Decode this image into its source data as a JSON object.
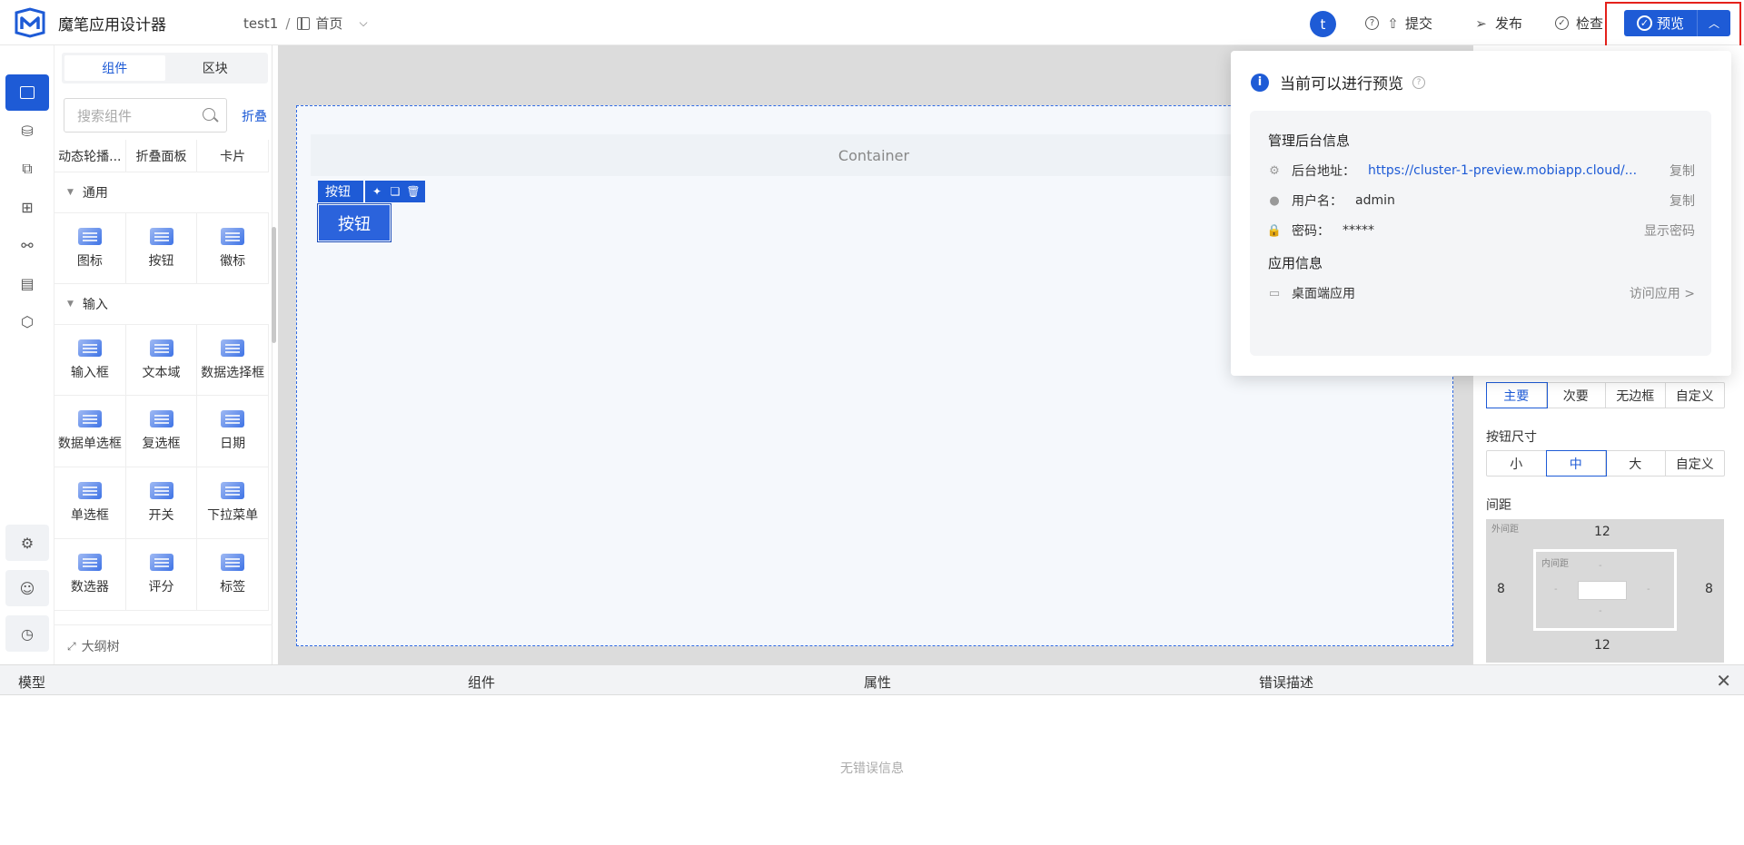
{
  "app": {
    "title": "魔笔应用设计器"
  },
  "breadcrumb": {
    "project": "test1",
    "separator": "/",
    "page": "首页"
  },
  "user": {
    "avatar_letter": "t"
  },
  "toolbar": {
    "submit": "提交",
    "publish": "发布",
    "check": "检查",
    "preview": "预览"
  },
  "colors": {
    "accent": "#1e5bd6",
    "highlight": "#e4211b"
  },
  "component_panel": {
    "tabs": [
      "组件",
      "区块"
    ],
    "search_placeholder": "搜索组件",
    "collapse_label": "折叠",
    "top_row": [
      "动态轮播...",
      "折叠面板",
      "卡片"
    ],
    "groups": [
      {
        "title": "通用",
        "items": [
          "图标",
          "按钮",
          "徽标"
        ]
      },
      {
        "title": "输入",
        "items": [
          "输入框",
          "文本域",
          "数据选择框",
          "数据单选框",
          "复选框",
          "日期",
          "单选框",
          "开关",
          "下拉菜单",
          "数选器",
          "评分",
          "标签"
        ]
      }
    ],
    "outline_tree": "大纲树"
  },
  "canvas": {
    "container_label": "Container",
    "selected_tag": "按钮",
    "button_label": "按钮"
  },
  "properties": {
    "style_options": [
      "主要",
      "次要",
      "无边框",
      "自定义"
    ],
    "style_selected": "主要",
    "size_label": "按钮尺寸",
    "size_options": [
      "小",
      "中",
      "大",
      "自定义"
    ],
    "size_selected": "中",
    "spacing_label": "间距",
    "outer_label": "外间距",
    "inner_label": "内间距",
    "margin_top": "12",
    "margin_bottom": "12",
    "margin_left": "8",
    "margin_right": "8",
    "padding_placeholder": "-"
  },
  "popover": {
    "title": "当前可以进行预览",
    "admin_section": "管理后台信息",
    "admin_url_label": "后台地址：",
    "admin_url": "https://cluster-1-preview.mobiapp.cloud/...",
    "copy": "复制",
    "username_label": "用户名：",
    "username": "admin",
    "password_label": "密码：",
    "password": "*****",
    "show_password": "显示密码",
    "app_section": "应用信息",
    "desktop_app": "桌面端应用",
    "visit_app": "访问应用 >"
  },
  "bottom_panel": {
    "columns": [
      "模型",
      "组件",
      "属性",
      "错误描述"
    ],
    "empty": "无错误信息"
  }
}
